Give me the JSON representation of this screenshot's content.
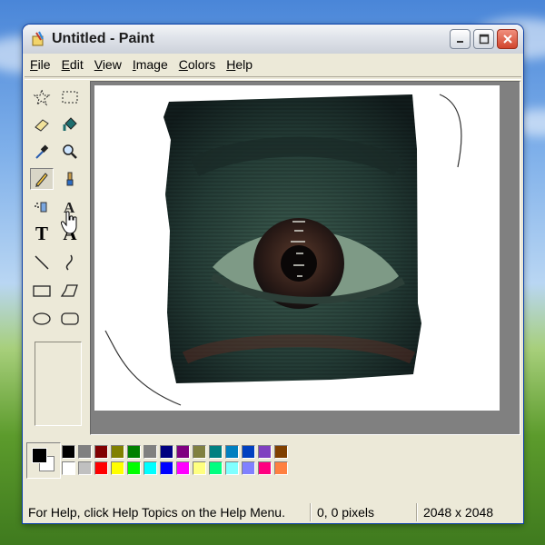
{
  "window": {
    "title": "Untitled - Paint",
    "controls": {
      "minimize": "minimize-icon",
      "maximize": "maximize-icon",
      "close": "close-icon"
    }
  },
  "menu": [
    "File",
    "Edit",
    "View",
    "Image",
    "Colors",
    "Help"
  ],
  "tools": [
    {
      "name": "free-form-select",
      "icon": "star-select-icon"
    },
    {
      "name": "rect-select",
      "icon": "dashed-rect-icon"
    },
    {
      "name": "eraser",
      "icon": "eraser-icon"
    },
    {
      "name": "fill",
      "icon": "paint-bucket-icon"
    },
    {
      "name": "pick-color",
      "icon": "eyedropper-icon"
    },
    {
      "name": "magnifier",
      "icon": "magnifier-icon"
    },
    {
      "name": "pencil",
      "icon": "pencil-icon",
      "selected": true
    },
    {
      "name": "brush",
      "icon": "brush-icon"
    },
    {
      "name": "airbrush",
      "icon": "airbrush-icon"
    },
    {
      "name": "text",
      "icon": "text-a-icon"
    },
    {
      "name": "text-bold",
      "icon": "text-t-icon",
      "label": "T"
    },
    {
      "name": "text-serif",
      "icon": "text-a-serif-icon",
      "label": "A"
    },
    {
      "name": "line",
      "icon": "line-icon"
    },
    {
      "name": "curve",
      "icon": "curve-icon"
    },
    {
      "name": "rectangle",
      "icon": "rectangle-icon"
    },
    {
      "name": "polygon",
      "icon": "polygon-icon"
    },
    {
      "name": "ellipse",
      "icon": "ellipse-icon"
    },
    {
      "name": "rounded-rectangle",
      "icon": "rounded-rect-icon"
    }
  ],
  "colors": {
    "foreground": "#000000",
    "background": "#ffffff",
    "palette_top": [
      "#000000",
      "#808080",
      "#800000",
      "#808000",
      "#008000",
      "#808080",
      "#000080",
      "#800080",
      "#808040",
      "#008080",
      "#0080c0",
      "#0040c0",
      "#8040c0",
      "#804000"
    ],
    "palette_bottom": [
      "#ffffff",
      "#c0c0c0",
      "#ff0000",
      "#ffff00",
      "#00ff00",
      "#00ffff",
      "#0000ff",
      "#ff00ff",
      "#ffff80",
      "#00ff80",
      "#80ffff",
      "#8080ff",
      "#ff0080",
      "#ff8040"
    ]
  },
  "status": {
    "help": "For Help, click Help Topics on the Help Menu.",
    "position": "0, 0 pixels",
    "dimensions": "2048 x 2048"
  }
}
